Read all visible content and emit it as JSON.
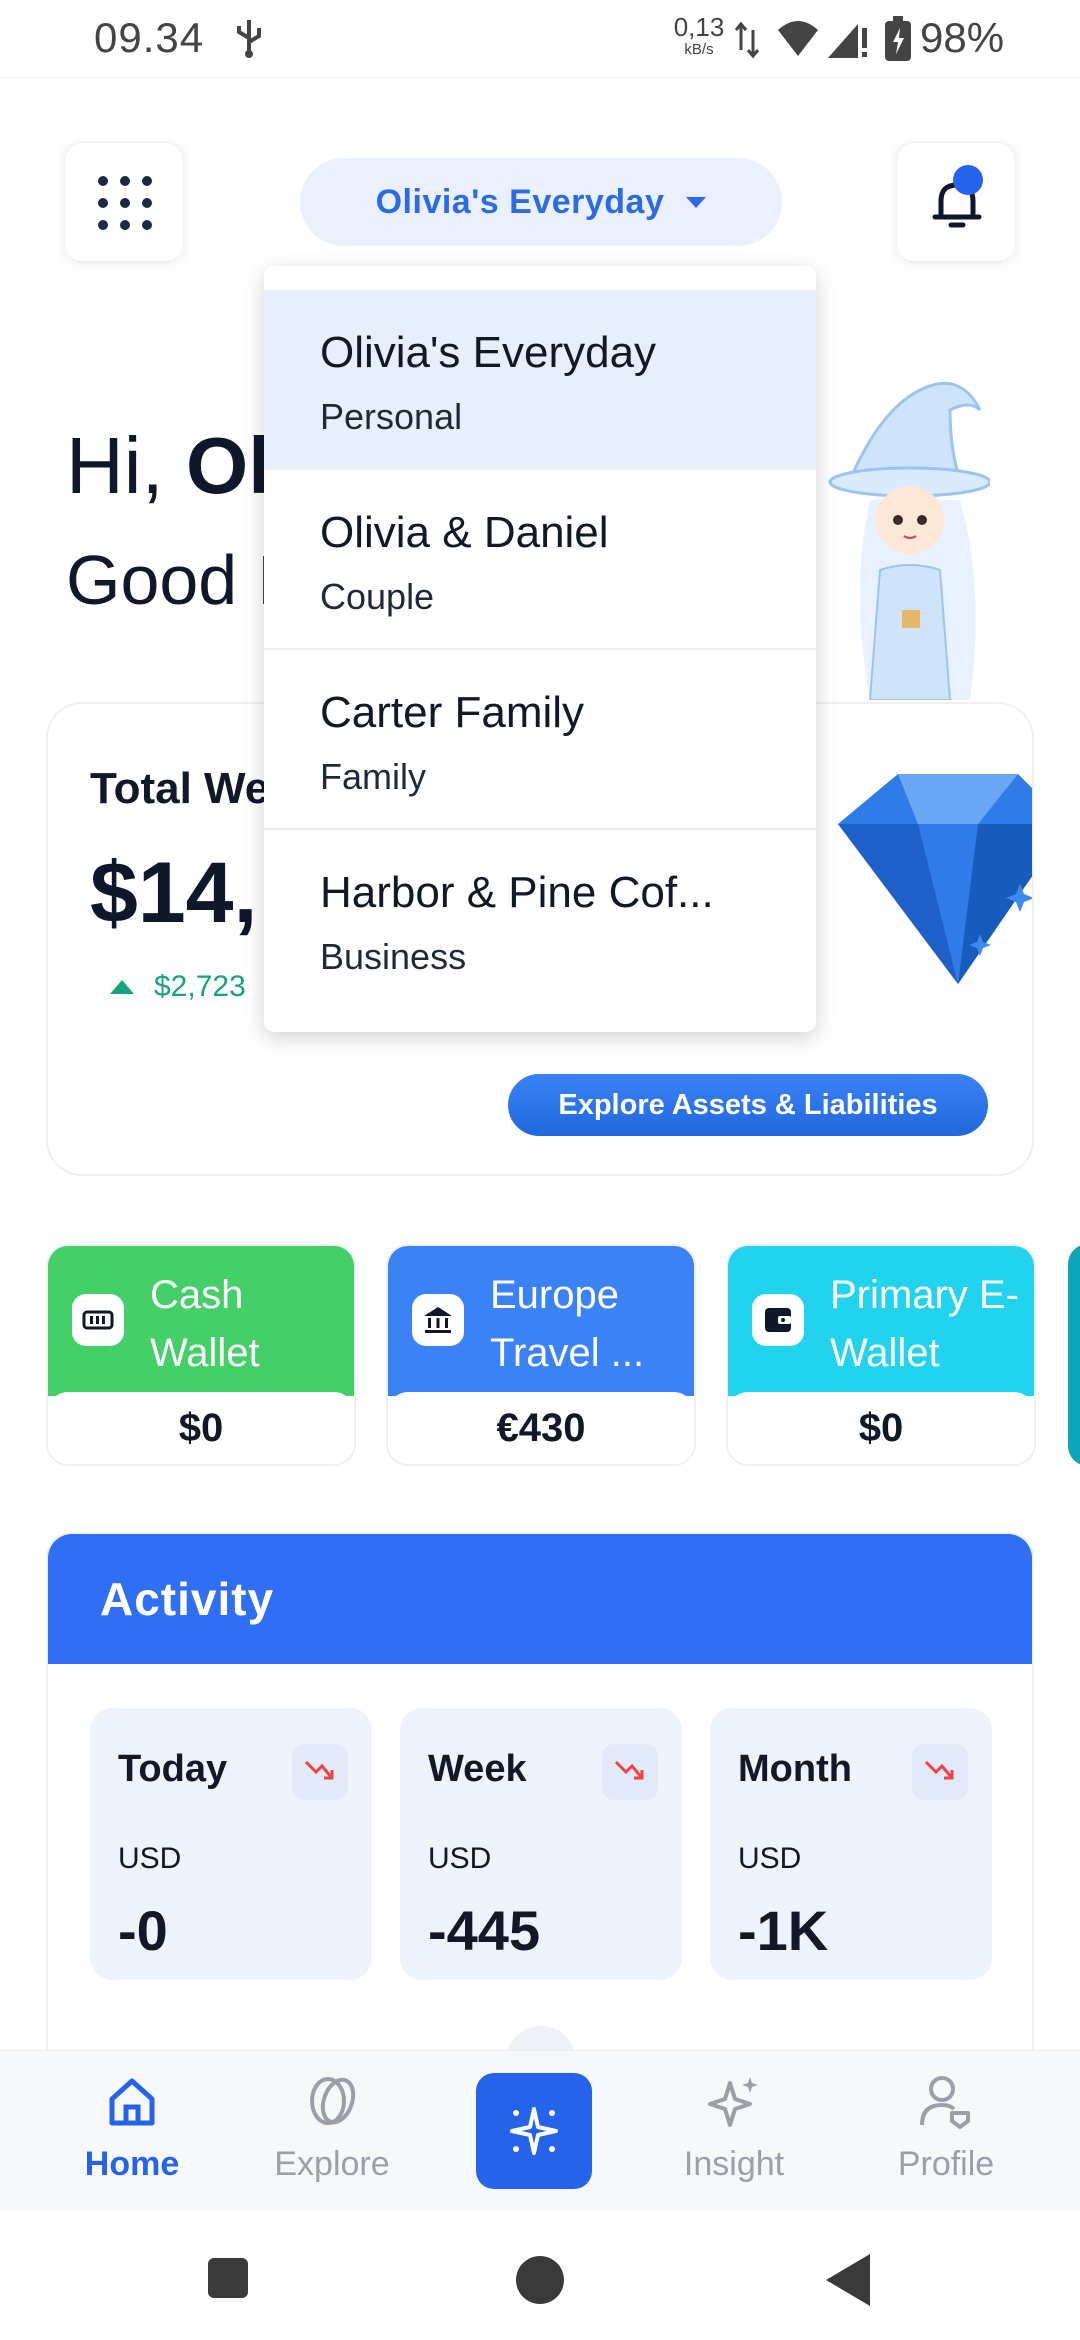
{
  "status_bar": {
    "time": "09.34",
    "net_speed_value": "0,13",
    "net_speed_unit": "kB/s",
    "battery": "98%"
  },
  "header": {
    "account_selected": "Olivia's Everyday"
  },
  "greeting": {
    "hi_prefix": "Hi, ",
    "name_partial": "Ol",
    "subtitle_partial": "Good I"
  },
  "wealth": {
    "title_partial": "Total We",
    "amount_partial": "$14,",
    "change_partial": "$2,723",
    "explore_button": "Explore Assets & Liabilities"
  },
  "wallets": [
    {
      "name": "Cash Wallet",
      "balance": "$0",
      "color": "#44cf68"
    },
    {
      "name": "Europe Travel ...",
      "balance": "€430",
      "color": "#3b82f6"
    },
    {
      "name": "Primary E-Wallet",
      "balance": "$0",
      "color": "#22d3ee"
    }
  ],
  "activity": {
    "title": "Activity",
    "stats": [
      {
        "label": "Today",
        "currency": "USD",
        "value": "-0"
      },
      {
        "label": "Week",
        "currency": "USD",
        "value": "-445"
      },
      {
        "label": "Month",
        "currency": "USD",
        "value": "-1K"
      }
    ]
  },
  "dropdown": {
    "items": [
      {
        "name": "Olivia's Everyday",
        "type": "Personal",
        "selected": true
      },
      {
        "name": "Olivia & Daniel",
        "type": "Couple",
        "selected": false
      },
      {
        "name": "Carter Family",
        "type": "Family",
        "selected": false
      },
      {
        "name": "Harbor & Pine Cof...",
        "type": "Business",
        "selected": false
      }
    ]
  },
  "bottom_nav": {
    "items": [
      {
        "label": "Home",
        "icon": "home-icon",
        "active": true
      },
      {
        "label": "Explore",
        "icon": "explore-icon",
        "active": false
      },
      {
        "label": "",
        "icon": "sparkle-icon",
        "active": false
      },
      {
        "label": "Insight",
        "icon": "insight-icon",
        "active": false
      },
      {
        "label": "Profile",
        "icon": "profile-icon",
        "active": false
      }
    ]
  },
  "colors": {
    "accent": "#2563eb",
    "activity_header": "#2f6ef5",
    "positive": "#16a37f",
    "negative": "#ef4444"
  }
}
